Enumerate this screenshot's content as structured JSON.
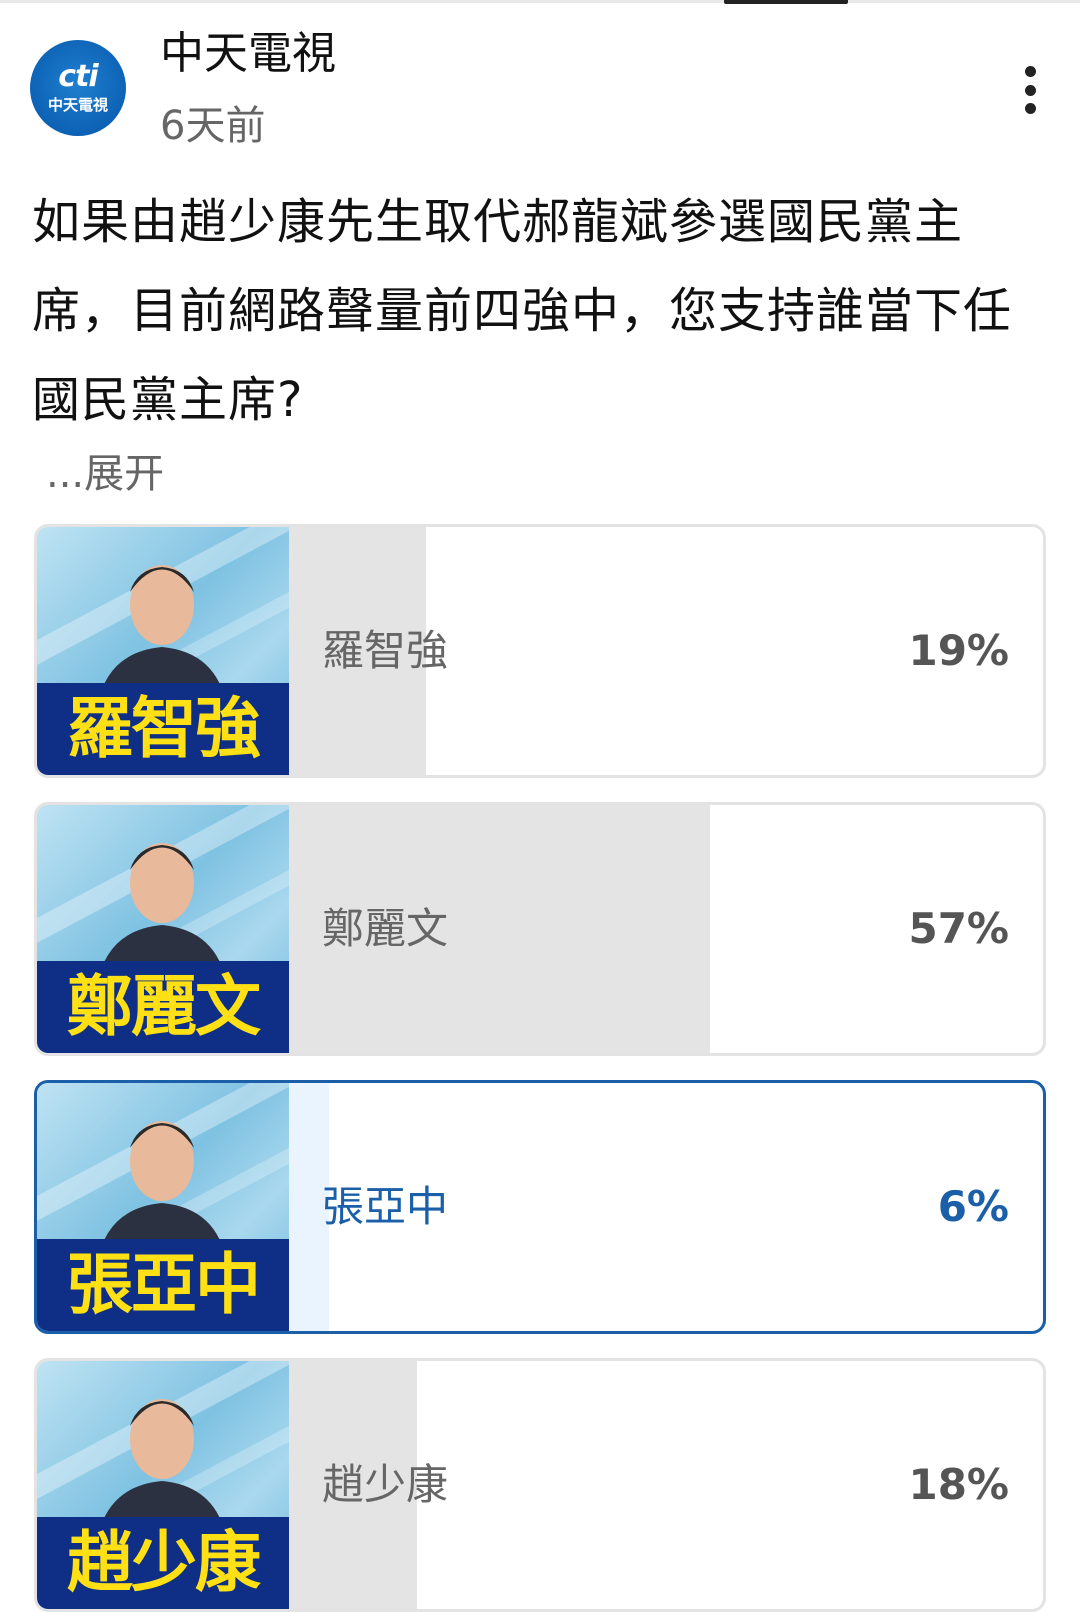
{
  "post": {
    "channel": "中天電視",
    "avatar_logo": "cti",
    "avatar_sub": "中天電視",
    "time": "6天前",
    "question": "如果由趙少康先生取代郝龍斌參選國民黨主席，目前網路聲量前四強中，您支持誰當下任國民黨主席?",
    "expand_label": "...展开"
  },
  "poll": {
    "options": [
      {
        "name": "羅智強",
        "thumb_name": "羅智強",
        "percent_label": "19%",
        "percent": 19,
        "selected": false
      },
      {
        "name": "鄭麗文",
        "thumb_name": "鄭麗文",
        "percent_label": "57%",
        "percent": 57,
        "selected": false
      },
      {
        "name": "張亞中",
        "thumb_name": "張亞中",
        "percent_label": "6%",
        "percent": 6,
        "selected": true
      },
      {
        "name": "趙少康",
        "thumb_name": "趙少康",
        "percent_label": "18%",
        "percent": 18,
        "selected": false
      }
    ]
  },
  "icons": {
    "more": "more-vertical-icon"
  },
  "colors": {
    "accent": "#1a5fa8",
    "fill": "#e4e4e4",
    "selected_fill": "#eaf4fe",
    "nameplate_bg": "#0f2f86",
    "nameplate_text": "#ffe014"
  }
}
